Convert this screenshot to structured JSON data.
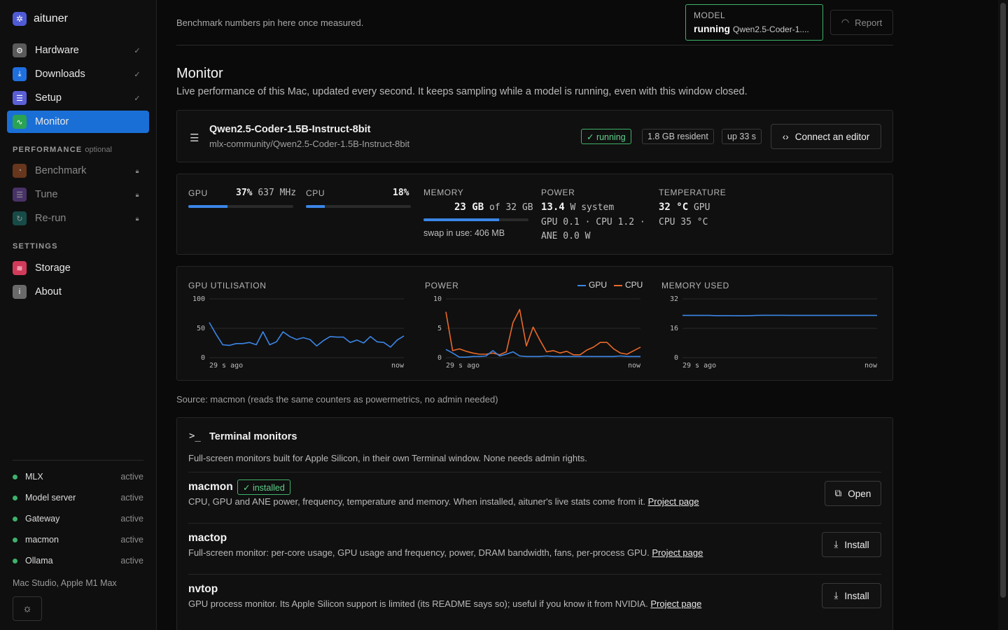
{
  "app": {
    "name": "aituner",
    "logo_glyph": "✲"
  },
  "sidebar": {
    "nav": [
      {
        "id": "hardware",
        "label": "Hardware",
        "icon": "cpu-icon",
        "glyph": "⚙",
        "color": "#5a5a5a",
        "trail": "✓"
      },
      {
        "id": "downloads",
        "label": "Downloads",
        "icon": "download-icon",
        "glyph": "⤓",
        "color": "#1f6fe0",
        "trail": "✓"
      },
      {
        "id": "setup",
        "label": "Setup",
        "icon": "setup-icon",
        "glyph": "☰",
        "color": "#5b5fd6",
        "trail": "✓"
      },
      {
        "id": "monitor",
        "label": "Monitor",
        "icon": "activity-icon",
        "glyph": "∿",
        "color": "#2aa352",
        "trail": ""
      }
    ],
    "performance_label": "PERFORMANCE",
    "performance_optional": "optional",
    "performance": [
      {
        "id": "benchmark",
        "label": "Benchmark",
        "icon": "gauge-icon",
        "glyph": "◔",
        "color": "#b0562a",
        "trail": "🔒"
      },
      {
        "id": "tune",
        "label": "Tune",
        "icon": "sliders-icon",
        "glyph": "☰",
        "color": "#7a4fb0",
        "trail": "🔒"
      },
      {
        "id": "rerun",
        "label": "Re-run",
        "icon": "refresh-icon",
        "glyph": "↻",
        "color": "#1f7d78",
        "trail": "🔒"
      }
    ],
    "settings_label": "SETTINGS",
    "settings": [
      {
        "id": "storage",
        "label": "Storage",
        "icon": "database-icon",
        "glyph": "≋",
        "color": "#d23a5a"
      },
      {
        "id": "about",
        "label": "About",
        "icon": "info-icon",
        "glyph": "i",
        "color": "#6a6a6a"
      }
    ],
    "services": [
      {
        "name": "MLX",
        "status": "active"
      },
      {
        "name": "Model server",
        "status": "active"
      },
      {
        "name": "Gateway",
        "status": "active"
      },
      {
        "name": "macmon",
        "status": "active"
      },
      {
        "name": "Ollama",
        "status": "active"
      }
    ],
    "machine": "Mac Studio, Apple M1 Max",
    "theme_glyph": "☼"
  },
  "header": {
    "hint": "Benchmark numbers pin here once measured.",
    "model_label": "MODEL",
    "model_state": "running",
    "model_name": "Qwen2.5-Coder-1....",
    "report_label": "Report"
  },
  "page": {
    "title": "Monitor",
    "subtitle": "Live performance of this Mac, updated every second. It keeps sampling while a model is running, even with this window closed."
  },
  "model_card": {
    "name": "Qwen2.5-Coder-1.5B-Instruct-8bit",
    "repo": "mlx-community/Qwen2.5-Coder-1.5B-Instruct-8bit",
    "running": "✓ running",
    "resident": "1.8 GB resident",
    "uptime": "up 33 s",
    "connect_label": "Connect an editor"
  },
  "stats": {
    "gpu": {
      "label": "GPU",
      "pct": "37%",
      "freq": "637 MHz",
      "fill": 0.37
    },
    "cpu": {
      "label": "CPU",
      "pct": "18%",
      "fill": 0.18
    },
    "memory": {
      "label": "MEMORY",
      "used": "23 GB",
      "of": "of 32 GB",
      "fill": 0.72,
      "swap": "swap in use: 406 MB"
    },
    "power": {
      "label": "POWER",
      "total": "13.4",
      "unit": "W system",
      "line2": "GPU 0.1 · CPU 1.2 ·",
      "line3": "ANE 0.0 W"
    },
    "temperature": {
      "label": "TEMPERATURE",
      "gpu": "32 °C",
      "gpu_unit": "GPU",
      "cpu": "CPU 35 °C"
    }
  },
  "chart_data": [
    {
      "type": "line",
      "title": "GPU UTILISATION",
      "ylim": [
        0,
        100
      ],
      "yticks": [
        "0",
        "50",
        "100"
      ],
      "xlabels": [
        "29 s ago",
        "now"
      ],
      "color": "#3b86e6",
      "series": [
        {
          "values": [
            60,
            40,
            22,
            21,
            24,
            24,
            26,
            22,
            44,
            22,
            27,
            44,
            36,
            31,
            34,
            31,
            20,
            29,
            36,
            35,
            35,
            26,
            30,
            25,
            36,
            27,
            26,
            18,
            30,
            37
          ]
        }
      ]
    },
    {
      "type": "line",
      "title": "POWER",
      "ylim": [
        0,
        10
      ],
      "yticks": [
        "0",
        "5",
        "10"
      ],
      "xlabels": [
        "29 s ago",
        "now"
      ],
      "series": [
        {
          "name": "GPU",
          "color": "#3b86e6",
          "values": [
            1.4,
            0.8,
            0.1,
            0.1,
            0.2,
            0.2,
            0.3,
            1.2,
            0.3,
            0.6,
            1.0,
            0.3,
            0.2,
            0.2,
            0.2,
            0.3,
            0.2,
            0.2,
            0.2,
            0.2,
            0.2,
            0.2,
            0.2,
            0.2,
            0.2,
            0.2,
            0.3,
            0.2,
            0.2,
            0.2
          ]
        },
        {
          "name": "CPU",
          "color": "#e8692a",
          "values": [
            7.8,
            1.2,
            1.5,
            1.1,
            0.8,
            0.6,
            0.6,
            0.8,
            0.5,
            1.0,
            6.0,
            8.2,
            2.0,
            5.2,
            3.0,
            1.0,
            1.2,
            0.8,
            1.1,
            0.5,
            0.5,
            1.3,
            1.8,
            2.6,
            2.6,
            1.5,
            0.8,
            0.6,
            1.2,
            1.8
          ]
        }
      ]
    },
    {
      "type": "line",
      "title": "MEMORY USED",
      "ylim": [
        0,
        32
      ],
      "yticks": [
        "0",
        "16",
        "32"
      ],
      "xlabels": [
        "29 s ago",
        "now"
      ],
      "color": "#3b86e6",
      "series": [
        {
          "values": [
            23,
            23,
            23,
            23,
            23,
            22.9,
            22.9,
            22.9,
            22.8,
            22.8,
            22.9,
            23,
            23.1,
            23.1,
            23.1,
            23.1,
            23,
            23,
            23,
            23,
            23,
            23,
            23,
            23,
            23,
            23,
            23,
            23,
            23,
            23
          ]
        }
      ]
    }
  ],
  "source_note": "Source: macmon (reads the same counters as powermetrics, no admin needed)",
  "terminal": {
    "title": "Terminal monitors",
    "description": "Full-screen monitors built for Apple Silicon, in their own Terminal window. None needs admin rights.",
    "tools": [
      {
        "name": "macmon",
        "installed": "✓ installed",
        "desc": "CPU, GPU and ANE power, frequency, temperature and memory. When installed, aituner's live stats come from it.",
        "link": "Project page",
        "action": "Open",
        "action_icon": "external-link-icon",
        "glyph": "⧉"
      },
      {
        "name": "mactop",
        "installed": "",
        "desc": "Full-screen monitor: per-core usage, GPU usage and frequency, power, DRAM bandwidth, fans, per-process GPU.",
        "link": "Project page",
        "action": "Install",
        "action_icon": "download-icon",
        "glyph": "⤓"
      },
      {
        "name": "nvtop",
        "installed": "",
        "desc": "GPU process monitor. Its Apple Silicon support is limited (its README says so); useful if you know it from NVIDIA.",
        "link": "Project page",
        "action": "Install",
        "action_icon": "download-icon",
        "glyph": "⤓"
      }
    ]
  }
}
